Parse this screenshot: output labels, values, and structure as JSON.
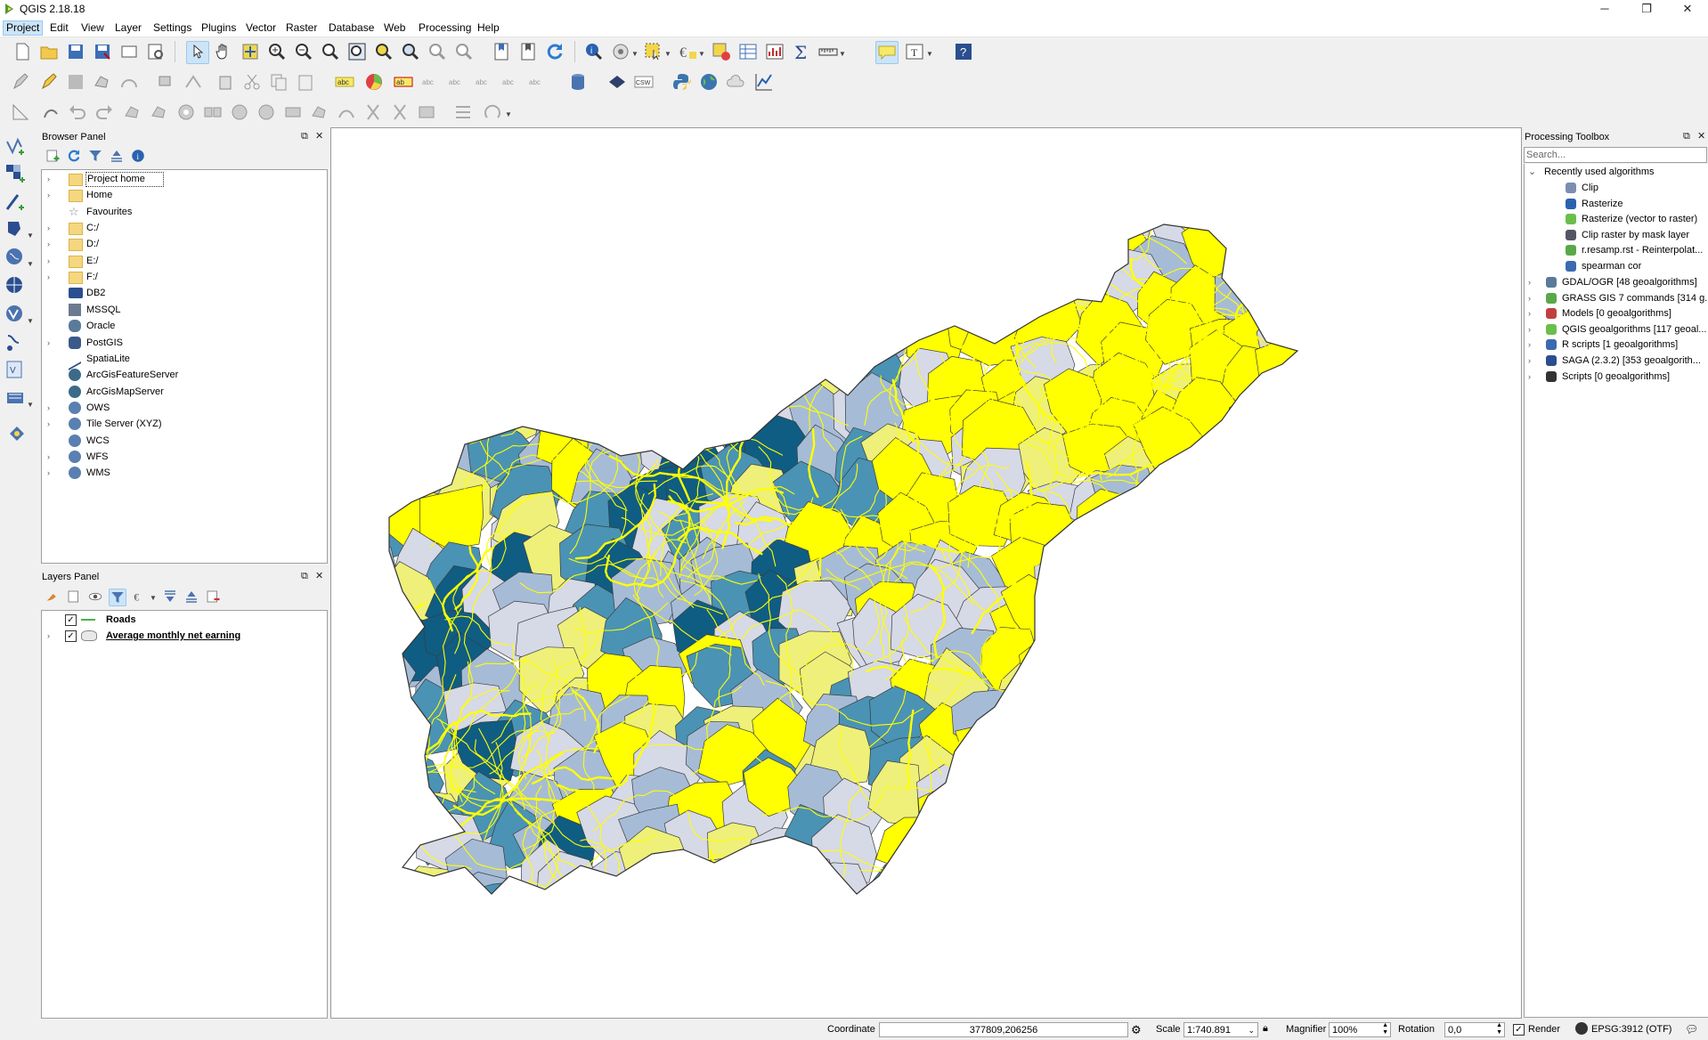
{
  "window": {
    "title": "QGIS 2.18.18",
    "minimize": "─",
    "restore": "❐",
    "close": "✕"
  },
  "menubar": {
    "items": [
      "Project",
      "Edit",
      "View",
      "Layer",
      "Settings",
      "Plugins",
      "Vector",
      "Raster",
      "Database",
      "Web",
      "Processing",
      "Help"
    ],
    "active": "Project"
  },
  "browser_panel": {
    "title": "Browser Panel",
    "items": [
      {
        "label": "Project home",
        "expandable": true,
        "icon": "folder-icon",
        "selected": true
      },
      {
        "label": "Home",
        "expandable": true,
        "icon": "folder-icon"
      },
      {
        "label": "Favourites",
        "expandable": false,
        "icon": "star-icon"
      },
      {
        "label": "C:/",
        "expandable": true,
        "icon": "folder-icon"
      },
      {
        "label": "D:/",
        "expandable": true,
        "icon": "folder-icon"
      },
      {
        "label": "E:/",
        "expandable": true,
        "icon": "folder-icon"
      },
      {
        "label": "F:/",
        "expandable": true,
        "icon": "folder-icon"
      },
      {
        "label": "DB2",
        "expandable": false,
        "icon": "db2-icon"
      },
      {
        "label": "MSSQL",
        "expandable": false,
        "icon": "mssql-icon"
      },
      {
        "label": "Oracle",
        "expandable": false,
        "icon": "oracle-icon"
      },
      {
        "label": "PostGIS",
        "expandable": true,
        "icon": "postgis-icon"
      },
      {
        "label": "SpatiaLite",
        "expandable": false,
        "icon": "spatialite-icon"
      },
      {
        "label": "ArcGisFeatureServer",
        "expandable": false,
        "icon": "arcgis-icon"
      },
      {
        "label": "ArcGisMapServer",
        "expandable": false,
        "icon": "arcgis-icon"
      },
      {
        "label": "OWS",
        "expandable": true,
        "icon": "globe-icon"
      },
      {
        "label": "Tile Server (XYZ)",
        "expandable": true,
        "icon": "globe-icon"
      },
      {
        "label": "WCS",
        "expandable": false,
        "icon": "globe-icon"
      },
      {
        "label": "WFS",
        "expandable": true,
        "icon": "globe-icon"
      },
      {
        "label": "WMS",
        "expandable": true,
        "icon": "globe-icon"
      }
    ]
  },
  "layers_panel": {
    "title": "Layers Panel",
    "layers": [
      {
        "name": "Roads",
        "checked": true,
        "expandable": false,
        "symbol": "line-symbol-icon"
      },
      {
        "name": "Average monthly net earning",
        "checked": true,
        "expandable": true,
        "symbol": "polygon-symbol-icon"
      }
    ]
  },
  "processing_toolbox": {
    "title": "Processing Toolbox",
    "search_placeholder": "Search...",
    "recent_group": "Recently used algorithms",
    "recent": [
      {
        "label": "Clip",
        "icon": "clip-icon"
      },
      {
        "label": "Rasterize",
        "icon": "gdal-icon"
      },
      {
        "label": "Rasterize (vector to raster)",
        "icon": "rasterize-icon"
      },
      {
        "label": "Clip raster by mask layer",
        "icon": "clip-raster-icon"
      },
      {
        "label": "r.resamp.rst - Reinterpolat...",
        "icon": "grass-icon"
      },
      {
        "label": "spearman cor",
        "icon": "r-icon"
      }
    ],
    "providers": [
      {
        "label": "GDAL/OGR [48 geoalgorithms]",
        "icon": "gdal-icon"
      },
      {
        "label": "GRASS GIS 7 commands [314 g...",
        "icon": "grass-icon"
      },
      {
        "label": "Models [0 geoalgorithms]",
        "icon": "models-icon"
      },
      {
        "label": "QGIS geoalgorithms [117 geoal...",
        "icon": "qgis-icon"
      },
      {
        "label": "R scripts [1 geoalgorithms]",
        "icon": "r-icon"
      },
      {
        "label": "SAGA (2.3.2) [353 geoalgorith...",
        "icon": "saga-icon"
      },
      {
        "label": "Scripts [0 geoalgorithms]",
        "icon": "scripts-icon"
      }
    ]
  },
  "statusbar": {
    "coordinate_label": "Coordinate",
    "coordinate_value": "377809,206256",
    "scale_label": "Scale",
    "scale_value": "1:740.891",
    "magnifier_label": "Magnifier",
    "magnifier_value": "100%",
    "rotation_label": "Rotation",
    "rotation_value": "0,0",
    "render_label": "Render",
    "crs_label": "EPSG:3912 (OTF)"
  },
  "colors": {
    "class1": "#ffff00",
    "class2": "#eef07a",
    "class3": "#d6d9e6",
    "class4": "#a6bcd6",
    "class5": "#4a93b4",
    "class6": "#0f5d82",
    "roads": "#ffff00"
  }
}
